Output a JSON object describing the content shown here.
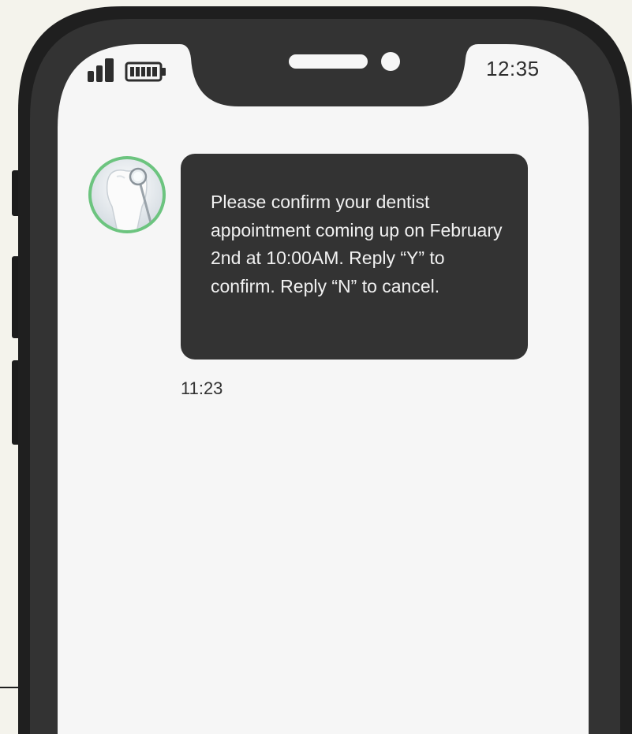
{
  "status_bar": {
    "time": "12:35",
    "signal_icon": "signal-bars-icon",
    "battery_icon": "battery-full-icon"
  },
  "conversation": {
    "sender_avatar_icon": "tooth-dental-mirror-icon",
    "messages": [
      {
        "text": "Please confirm your dentist appointment coming up on February 2nd at 10:00AM. Reply “Y” to confirm. Reply “N” to cancel.",
        "time": "11:23"
      }
    ]
  },
  "colors": {
    "phone_frame": "#333333",
    "screen_background": "#f6f6f6",
    "page_background": "#f4f3ec",
    "bubble_background": "#333333",
    "bubble_text": "#f1f1f1",
    "avatar_ring": "#6cc47f"
  }
}
